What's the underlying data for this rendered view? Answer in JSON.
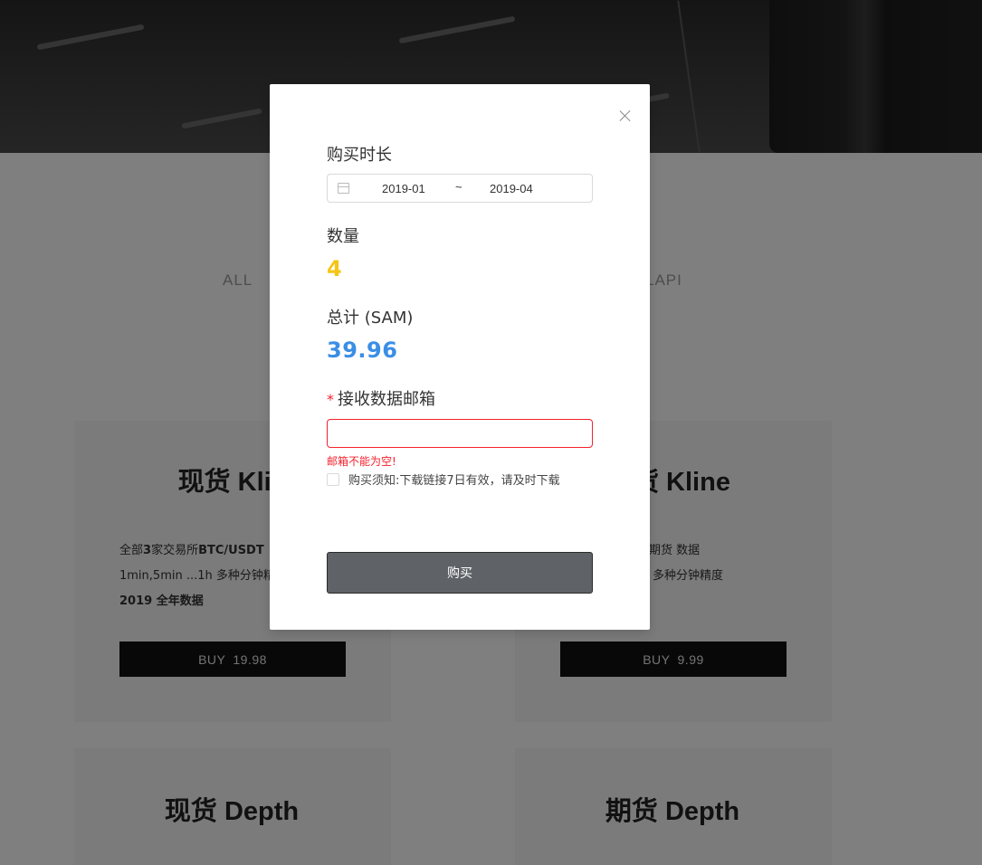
{
  "background": {
    "filters": {
      "all": "ALL",
      "api": "LAPI"
    },
    "cards": [
      {
        "title": "现货 Klin",
        "desc_line1_prefix": "全部",
        "desc_line1_num": "3",
        "desc_line1_mid": "家交易所",
        "desc_line1_pair": "BTC/USDT",
        "desc_line2": "1min,5min ...1h 多种分钟精",
        "desc_line3": "2019 全年数据",
        "buy_label": "BUY",
        "price": "19.98"
      },
      {
        "title": "货 Kline",
        "desc_line1": "期货 数据",
        "desc_line2": "多种分钟精度",
        "buy_label": "BUY",
        "price": "9.99"
      },
      {
        "title": "现货 Depth"
      },
      {
        "title": "期货 Depth"
      }
    ]
  },
  "modal": {
    "duration_label": "购买时长",
    "range_start": "2019-01",
    "range_separator": "~",
    "range_end": "2019-04",
    "quantity_label": "数量",
    "quantity_value": "4",
    "total_label": "总计 (SAM)",
    "total_value": "39.96",
    "email_required_mark": "*",
    "email_label": "接收数据邮箱",
    "email_value": "",
    "email_error": "邮箱不能为空!",
    "agreement_text": "购买须知:下载链接7日有效，请及时下载",
    "submit_label": "购买"
  },
  "colors": {
    "quantity": "#f5c518",
    "total": "#3a8ee6",
    "error": "#f5222d",
    "submit_bg": "#5f6266"
  }
}
